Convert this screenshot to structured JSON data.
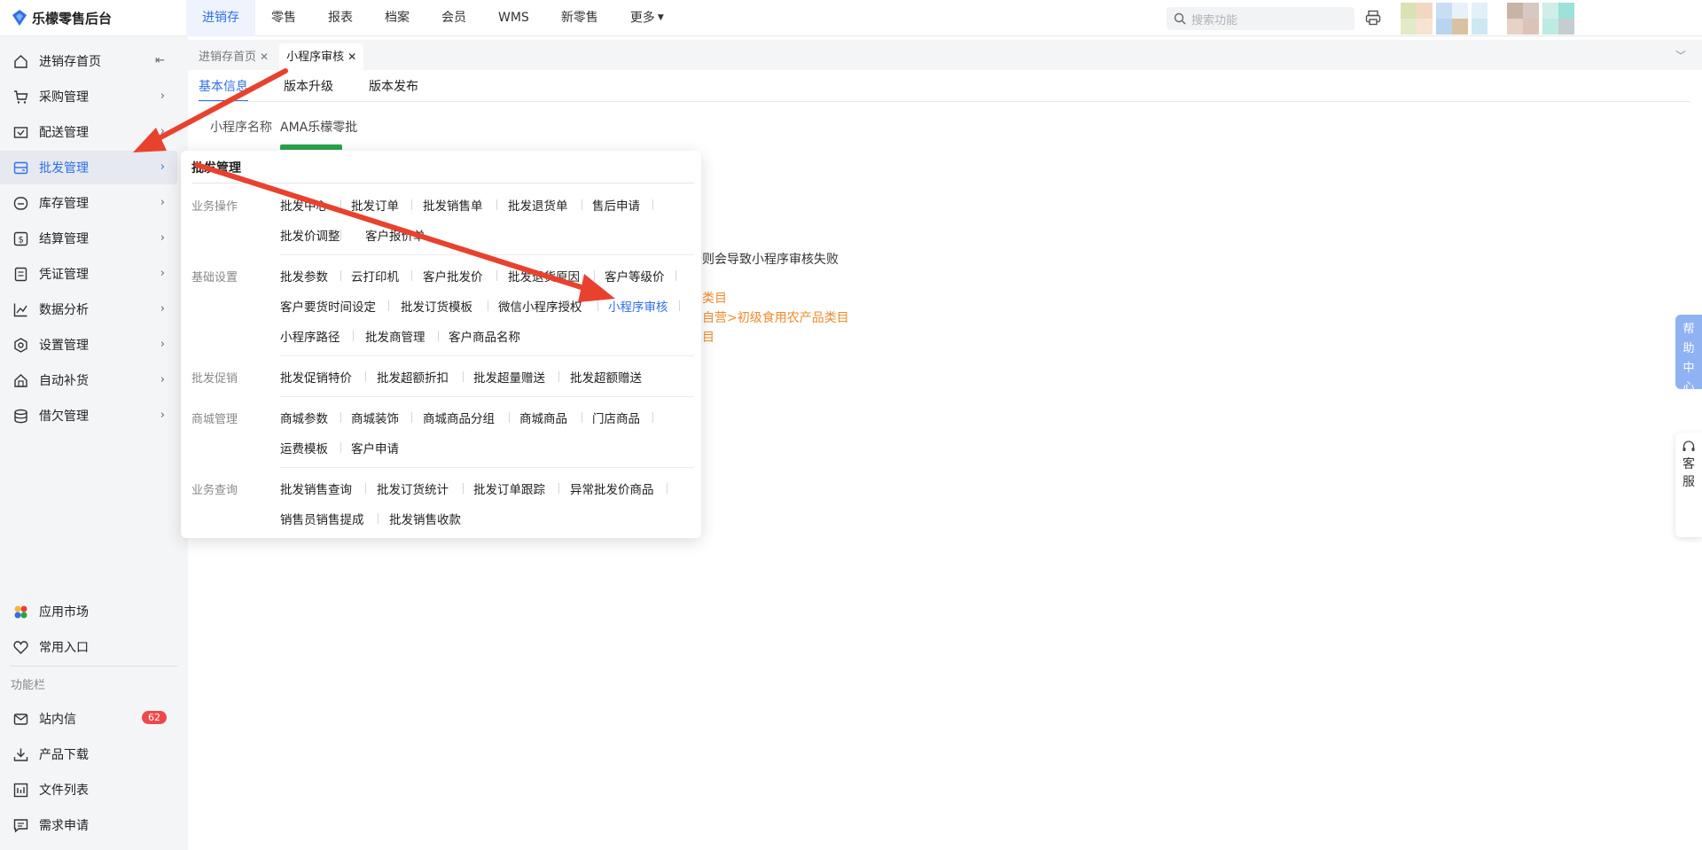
{
  "brand": {
    "name": "乐檬零售后台"
  },
  "topnav": {
    "items": [
      {
        "label": "进销存",
        "active": true
      },
      {
        "label": "零售"
      },
      {
        "label": "报表"
      },
      {
        "label": "档案"
      },
      {
        "label": "会员"
      },
      {
        "label": "WMS"
      },
      {
        "label": "新零售"
      },
      {
        "label": "更多"
      }
    ],
    "search_placeholder": "搜索功能"
  },
  "sidebar": {
    "collapse_icon": "collapse-left-icon",
    "items": [
      {
        "label": "进销存首页",
        "icon": "home-icon"
      },
      {
        "label": "采购管理",
        "icon": "cart-icon"
      },
      {
        "label": "配送管理",
        "icon": "delivery-icon"
      },
      {
        "label": "批发管理",
        "icon": "wholesale-icon",
        "active": true
      },
      {
        "label": "库存管理",
        "icon": "inventory-icon"
      },
      {
        "label": "结算管理",
        "icon": "settlement-icon"
      },
      {
        "label": "凭证管理",
        "icon": "voucher-icon"
      },
      {
        "label": "数据分析",
        "icon": "chart-icon"
      },
      {
        "label": "设置管理",
        "icon": "settings-icon"
      },
      {
        "label": "自动补货",
        "icon": "replenish-icon"
      },
      {
        "label": "借欠管理",
        "icon": "debt-icon"
      }
    ],
    "bottom": [
      {
        "label": "应用市场",
        "icon": "app-market-icon"
      },
      {
        "label": "常用入口",
        "icon": "heart-icon"
      }
    ],
    "section_label": "功能栏",
    "tools": [
      {
        "label": "站内信",
        "icon": "mail-icon",
        "badge": "62"
      },
      {
        "label": "产品下载",
        "icon": "download-icon"
      },
      {
        "label": "文件列表",
        "icon": "file-list-icon"
      },
      {
        "label": "需求申请",
        "icon": "request-icon"
      }
    ]
  },
  "tabs": [
    {
      "label": "进销存首页"
    },
    {
      "label": "小程序审核",
      "current": true
    }
  ],
  "content": {
    "subtabs": [
      "基本信息",
      "版本升级",
      "版本发布"
    ],
    "field_label": "小程序名称",
    "field_value": "AMA乐檬零批",
    "warning": "，否则会导致小程序审核失败",
    "orange_lines": [
      "品类目",
      "家自营>初级食用农产品类目",
      "类目"
    ]
  },
  "panel": {
    "title": "批发管理",
    "groups": [
      {
        "label": "业务操作",
        "links": [
          "批发中心",
          "批发订单",
          "批发销售单",
          "批发退货单",
          "售后申请",
          "批发价调整",
          "客户报价单"
        ]
      },
      {
        "label": "基础设置",
        "links": [
          "批发参数",
          "云打印机",
          "客户批发价",
          "批发退货原因",
          "客户等级价",
          "客户要货时间设定",
          "批发订货模板",
          "微信小程序授权",
          "小程序审核",
          "小程序路径",
          "批发商管理",
          "客户商品名称"
        ]
      },
      {
        "label": "批发促销",
        "links": [
          "批发促销特价",
          "批发超额折扣",
          "批发超量赠送",
          "批发超额赠送"
        ]
      },
      {
        "label": "商城管理",
        "links": [
          "商城参数",
          "商城装饰",
          "商城商品分组",
          "商城商品",
          "门店商品",
          "运费模板",
          "客户申请"
        ]
      },
      {
        "label": "业务查询",
        "links": [
          "批发销售查询",
          "批发订货统计",
          "批发订单跟踪",
          "异常批发价商品",
          "销售员销售提成",
          "批发销售收款"
        ]
      }
    ]
  },
  "float": {
    "help": [
      "帮",
      "助",
      "中",
      "心"
    ],
    "service": [
      "客",
      "服"
    ]
  },
  "colors": {
    "accent": "#2f6fe8",
    "annotation": "#e8422e",
    "orange": "#f08a2e",
    "badge": "#f04848"
  }
}
